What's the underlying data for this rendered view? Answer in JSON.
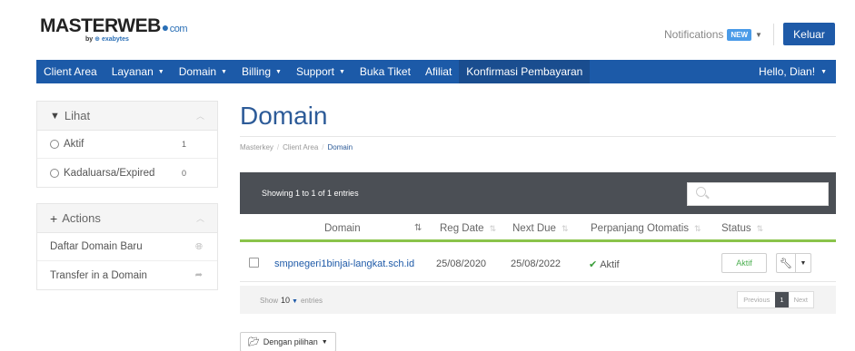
{
  "header": {
    "logo_main": "MASTERWEB",
    "logo_com": "com",
    "logo_by": "by",
    "logo_exa": "exabytes",
    "notifications_label": "Notifications",
    "notifications_badge": "NEW",
    "logout_label": "Keluar"
  },
  "nav": {
    "items": [
      {
        "label": "Client Area",
        "dropdown": false
      },
      {
        "label": "Layanan",
        "dropdown": true
      },
      {
        "label": "Domain",
        "dropdown": true
      },
      {
        "label": "Billing",
        "dropdown": true
      },
      {
        "label": "Support",
        "dropdown": true
      },
      {
        "label": "Buka Tiket",
        "dropdown": false
      },
      {
        "label": "Afiliat",
        "dropdown": false
      },
      {
        "label": "Konfirmasi Pembayaran",
        "dropdown": false
      }
    ],
    "greeting": "Hello, Dian!"
  },
  "sidebar": {
    "filter": {
      "title": "Lihat",
      "options": [
        {
          "label": "Aktif",
          "count": "1"
        },
        {
          "label": "Kadaluarsa/Expired",
          "count": "0"
        }
      ]
    },
    "actions": {
      "title": "Actions",
      "items": [
        {
          "label": "Daftar Domain Baru",
          "icon": "globe-icon"
        },
        {
          "label": "Transfer in a Domain",
          "icon": "share-arrow-icon"
        }
      ]
    }
  },
  "main": {
    "title": "Domain",
    "breadcrumb": [
      "Masterkey",
      "Client Area",
      "Domain"
    ],
    "table": {
      "info": "Showing 1 to 1 of 1 entries",
      "columns": [
        "Domain",
        "Reg Date",
        "Next Due",
        "Perpanjang Otomatis",
        "Status"
      ],
      "rows": [
        {
          "domain": "smpnegeri1binjai-langkat.sch.id",
          "reg_date": "25/08/2020",
          "next_due": "25/08/2022",
          "auto_renew": "Aktif",
          "status": "Aktif"
        }
      ],
      "footer": {
        "show_label": "Show",
        "entries_value": "10",
        "entries_label": "entries",
        "previous": "Previous",
        "page": "1",
        "next": "Next"
      }
    },
    "bulk_label": "Dengan pilihan"
  },
  "colors": {
    "brand": "#1c5aa8",
    "title": "#2d5b98",
    "status_green": "#4caf50",
    "header_bar": "#4b4f55",
    "accent_line": "#8ac34a"
  }
}
